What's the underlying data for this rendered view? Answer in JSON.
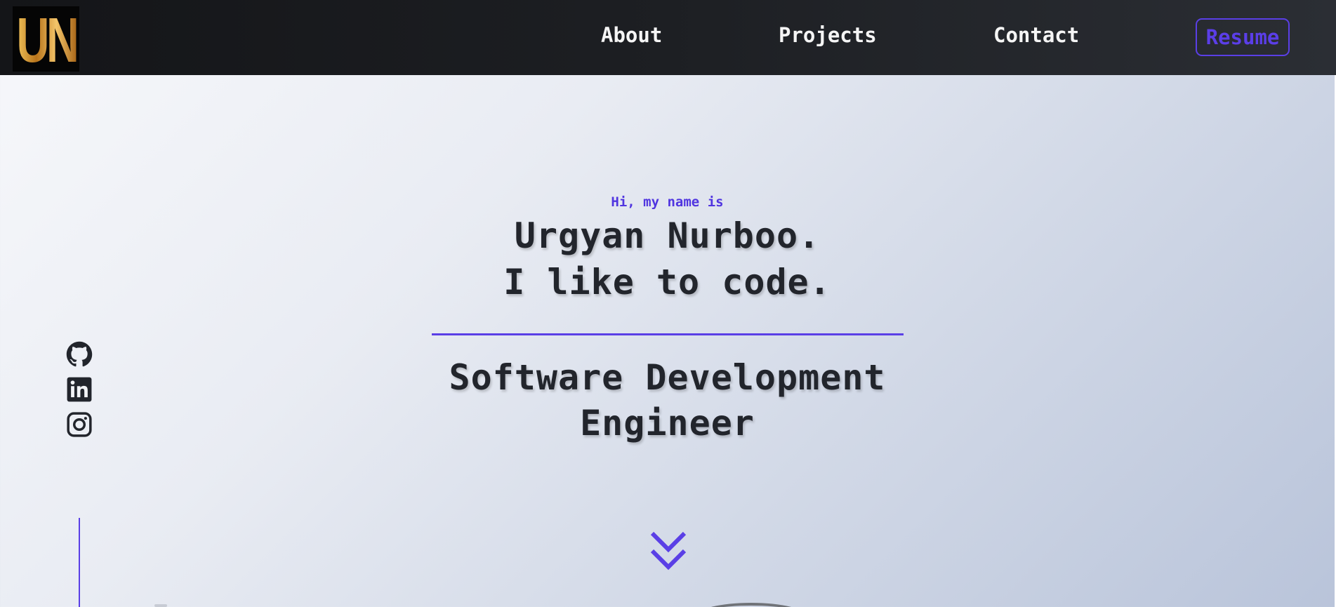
{
  "header": {
    "logo_text": "UN",
    "nav": [
      {
        "label": "About"
      },
      {
        "label": "Projects"
      },
      {
        "label": "Contact"
      }
    ],
    "resume_label": "Resume"
  },
  "hero": {
    "greeting": "Hi, my name is",
    "name": "Urgyan Nurboo.",
    "tagline": "I like to code.",
    "role_line_1": "Software Development",
    "role_line_2": "Engineer"
  },
  "socials": [
    {
      "icon": "github-icon"
    },
    {
      "icon": "linkedin-icon"
    },
    {
      "icon": "instagram-icon"
    }
  ],
  "colors": {
    "accent": "#5a3fe6",
    "header_bg": "#1d1f23",
    "text_dark": "#22252c",
    "logo_gold": "#d49a2e"
  }
}
